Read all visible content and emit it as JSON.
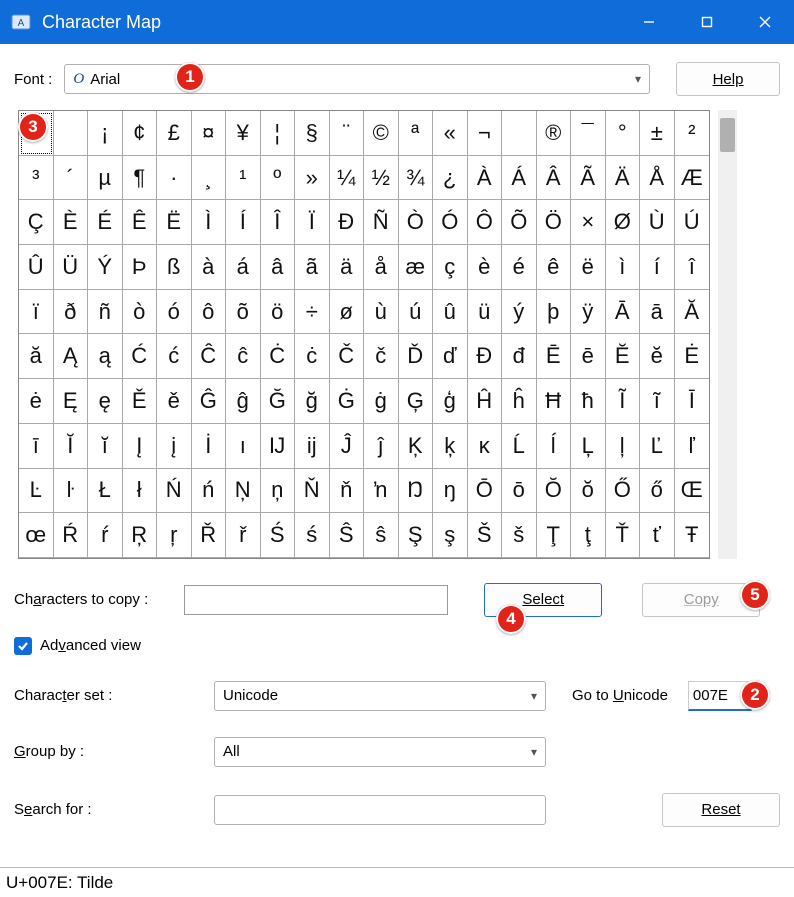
{
  "window": {
    "title": "Character Map"
  },
  "font_row": {
    "label": "Font :",
    "font_glyph": "O",
    "font_name": "Arial",
    "help": "Help"
  },
  "grid": {
    "rows": [
      [
        "~",
        " ",
        "¡",
        "¢",
        "£",
        "¤",
        "¥",
        "¦",
        "§",
        "¨",
        "©",
        "ª",
        "«",
        "¬",
        "­",
        "®",
        "¯",
        "°",
        "±",
        "²"
      ],
      [
        "³",
        "´",
        "µ",
        "¶",
        "·",
        "¸",
        "¹",
        "º",
        "»",
        "¼",
        "½",
        "¾",
        "¿",
        "À",
        "Á",
        "Â",
        "Ã",
        "Ä",
        "Å",
        "Æ"
      ],
      [
        "Ç",
        "È",
        "É",
        "Ê",
        "Ë",
        "Ì",
        "Í",
        "Î",
        "Ï",
        "Ð",
        "Ñ",
        "Ò",
        "Ó",
        "Ô",
        "Õ",
        "Ö",
        "×",
        "Ø",
        "Ù",
        "Ú"
      ],
      [
        "Û",
        "Ü",
        "Ý",
        "Þ",
        "ß",
        "à",
        "á",
        "â",
        "ã",
        "ä",
        "å",
        "æ",
        "ç",
        "è",
        "é",
        "ê",
        "ë",
        "ì",
        "í",
        "î"
      ],
      [
        "ï",
        "ð",
        "ñ",
        "ò",
        "ó",
        "ô",
        "õ",
        "ö",
        "÷",
        "ø",
        "ù",
        "ú",
        "û",
        "ü",
        "ý",
        "þ",
        "ÿ",
        "Ā",
        "ā",
        "Ă"
      ],
      [
        "ă",
        "Ą",
        "ą",
        "Ć",
        "ć",
        "Ĉ",
        "ĉ",
        "Ċ",
        "ċ",
        "Č",
        "č",
        "Ď",
        "ď",
        "Đ",
        "đ",
        "Ē",
        "ē",
        "Ĕ",
        "ĕ",
        "Ė"
      ],
      [
        "ė",
        "Ę",
        "ę",
        "Ě",
        "ě",
        "Ĝ",
        "ĝ",
        "Ğ",
        "ğ",
        "Ġ",
        "ġ",
        "Ģ",
        "ģ",
        "Ĥ",
        "ĥ",
        "Ħ",
        "ħ",
        "Ĩ",
        "ĩ",
        "Ī"
      ],
      [
        "ī",
        "Ĭ",
        "ĭ",
        "Į",
        "į",
        "İ",
        "ı",
        "Ĳ",
        "ĳ",
        "Ĵ",
        "ĵ",
        "Ķ",
        "ķ",
        "ĸ",
        "Ĺ",
        "ĺ",
        "Ļ",
        "ļ",
        "Ľ",
        "ľ"
      ],
      [
        "Ŀ",
        "ŀ",
        "Ł",
        "ł",
        "Ń",
        "ń",
        "Ņ",
        "ņ",
        "Ň",
        "ň",
        "ŉ",
        "Ŋ",
        "ŋ",
        "Ō",
        "ō",
        "Ŏ",
        "ŏ",
        "Ő",
        "ő",
        "Œ"
      ],
      [
        "œ",
        "Ŕ",
        "ŕ",
        "Ŗ",
        "ŗ",
        "Ř",
        "ř",
        "Ś",
        "ś",
        "Ŝ",
        "ŝ",
        "Ş",
        "ş",
        "Š",
        "š",
        "Ţ",
        "ţ",
        "Ť",
        "ť",
        "Ŧ"
      ]
    ],
    "selected": [
      0,
      0
    ]
  },
  "copy_row": {
    "label": "Characters to copy :",
    "value": "",
    "select": "Select",
    "copy": "Copy"
  },
  "advanced": {
    "label": "Advanced view",
    "checked": true
  },
  "charset": {
    "label": "Character set :",
    "value": "Unicode",
    "goto_label": "Go to Unicode",
    "goto_value": "007E"
  },
  "groupby": {
    "label": "Group by :",
    "value": "All"
  },
  "search": {
    "label": "Search for :",
    "value": "",
    "reset": "Reset"
  },
  "status": {
    "text": "U+007E: Tilde"
  },
  "badges": {
    "1": "1",
    "2": "2",
    "3": "3",
    "4": "4",
    "5": "5"
  }
}
